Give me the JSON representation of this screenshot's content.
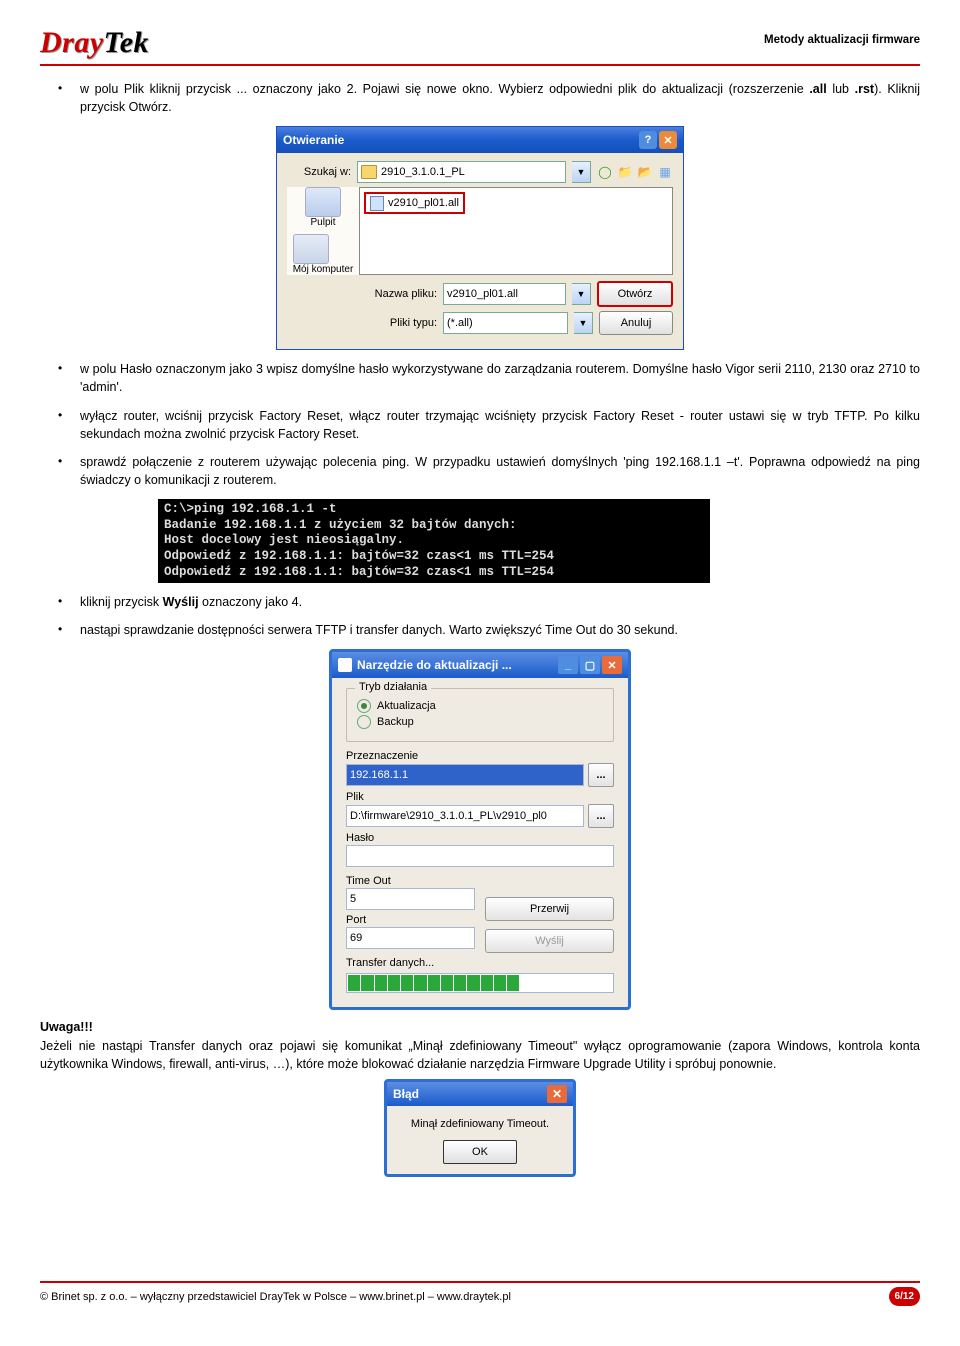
{
  "header": {
    "logo_dray": "Dray",
    "logo_tek": "Tek",
    "subtitle": "Metody aktualizacji firmware"
  },
  "para": {
    "b1a": "w polu Plik kliknij przycisk ... oznaczony jako 2. Pojawi się nowe okno. Wybierz odpowiedni plik do aktualizacji (rozszerzenie ",
    "b1b": ".all",
    "b1c": " lub ",
    "b1d": ".rst",
    "b1e": "). Kliknij przycisk Otwórz.",
    "b2": "w polu Hasło oznaczonym jako 3 wpisz domyślne hasło wykorzystywane do zarządzania routerem. Domyślne hasło Vigor serii 2110, 2130 oraz 2710 to 'admin'.",
    "b3": "wyłącz router, wciśnij przycisk Factory Reset, włącz router trzymając wciśnięty przycisk Factory Reset - router ustawi się w tryb TFTP. Po kilku sekundach można zwolnić przycisk Factory Reset.",
    "b4": "sprawdź połączenie z routerem używając polecenia ping. W przypadku ustawień domyślnych 'ping 192.168.1.1 –t'. Poprawna odpowiedź na ping świadczy o komunikacji z routerem.",
    "b5a": "kliknij przycisk ",
    "b5b": "Wyślij",
    "b5c": " oznaczony jako 4.",
    "b6": "nastąpi sprawdzanie dostępności serwera TFTP i transfer danych. Warto zwiększyć Time Out do 30 sekund."
  },
  "openDialog": {
    "title": "Otwieranie",
    "lookin_lbl": "Szukaj w:",
    "folder": "2910_3.1.0.1_PL",
    "file_item": "v2910_pl01.all",
    "place_desktop": "Pulpit",
    "place_computer": "Mój komputer",
    "filename_lbl": "Nazwa pliku:",
    "filename_val": "v2910_pl01.all",
    "filetype_lbl": "Pliki typu:",
    "filetype_val": "(*.all)",
    "open_btn": "Otwórz",
    "cancel_btn": "Anuluj"
  },
  "cmd": {
    "l1": "C:\\>ping 192.168.1.1 -t",
    "l2": "Badanie 192.168.1.1 z użyciem 32 bajtów danych:",
    "l3": "Host docelowy jest nieosiągalny.",
    "l4": "Odpowiedź z 192.168.1.1: bajtów=32 czas<1 ms TTL=254",
    "l5": "Odpowiedź z 192.168.1.1: bajtów=32 czas<1 ms TTL=254"
  },
  "tool": {
    "title": "Narzędzie do aktualizacji ...",
    "group_mode": "Tryb działania",
    "opt_update": "Aktualizacja",
    "opt_backup": "Backup",
    "dest_lbl": "Przeznaczenie",
    "dest_val": "192.168.1.1",
    "file_lbl": "Plik",
    "file_val": "D:\\firmware\\2910_3.1.0.1_PL\\v2910_pl0",
    "pass_lbl": "Hasło",
    "pass_val": "",
    "timeout_lbl": "Time Out",
    "timeout_val": "5",
    "port_lbl": "Port",
    "port_val": "69",
    "btn_cancel": "Przerwij",
    "btn_send": "Wyślij",
    "transfer_lbl": "Transfer danych...",
    "browse": "..."
  },
  "warning": {
    "head": "Uwaga!!!",
    "text": "Jeżeli nie nastąpi Transfer danych oraz pojawi się komunikat „Minął zdefiniowany Timeout\" wyłącz oprogramowanie (zapora Windows, kontrola konta użytkownika Windows, firewall, anti-virus, …), które może blokować działanie narzędzia Firmware Upgrade Utility i spróbuj ponownie."
  },
  "errWin": {
    "title": "Błąd",
    "msg": "Minął zdefiniowany Timeout.",
    "ok": "OK"
  },
  "footer": {
    "text": "© Brinet sp. z o.o. – wyłączny przedstawiciel DrayTek w Polsce – www.brinet.pl – www.draytek.pl",
    "page": "6/12"
  }
}
